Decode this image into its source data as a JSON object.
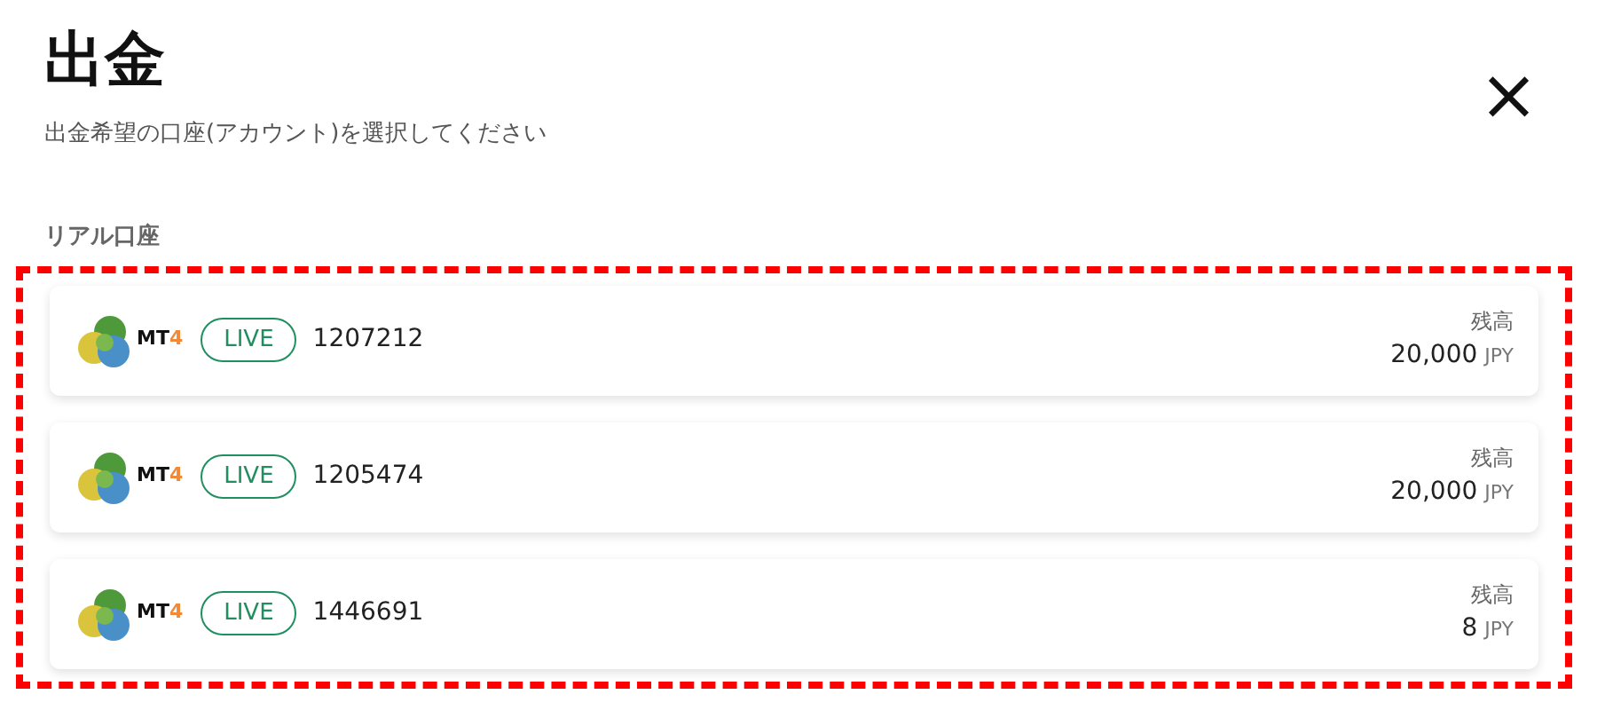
{
  "title": "出金",
  "subtitle": "出金希望の口座(アカウント)を選択してください",
  "close": "×",
  "section": {
    "label": "リアル口座",
    "highlighted": true,
    "accounts": [
      {
        "platform": "MT",
        "platform_version": "4",
        "badge": "LIVE",
        "number": "1207212",
        "balance_label": "残高",
        "balance": "20,000",
        "currency": "JPY"
      },
      {
        "platform": "MT",
        "platform_version": "4",
        "badge": "LIVE",
        "number": "1205474",
        "balance_label": "残高",
        "balance": "20,000",
        "currency": "JPY"
      },
      {
        "platform": "MT",
        "platform_version": "4",
        "badge": "LIVE",
        "number": "1446691",
        "balance_label": "残高",
        "balance": "8",
        "currency": "JPY"
      }
    ]
  }
}
